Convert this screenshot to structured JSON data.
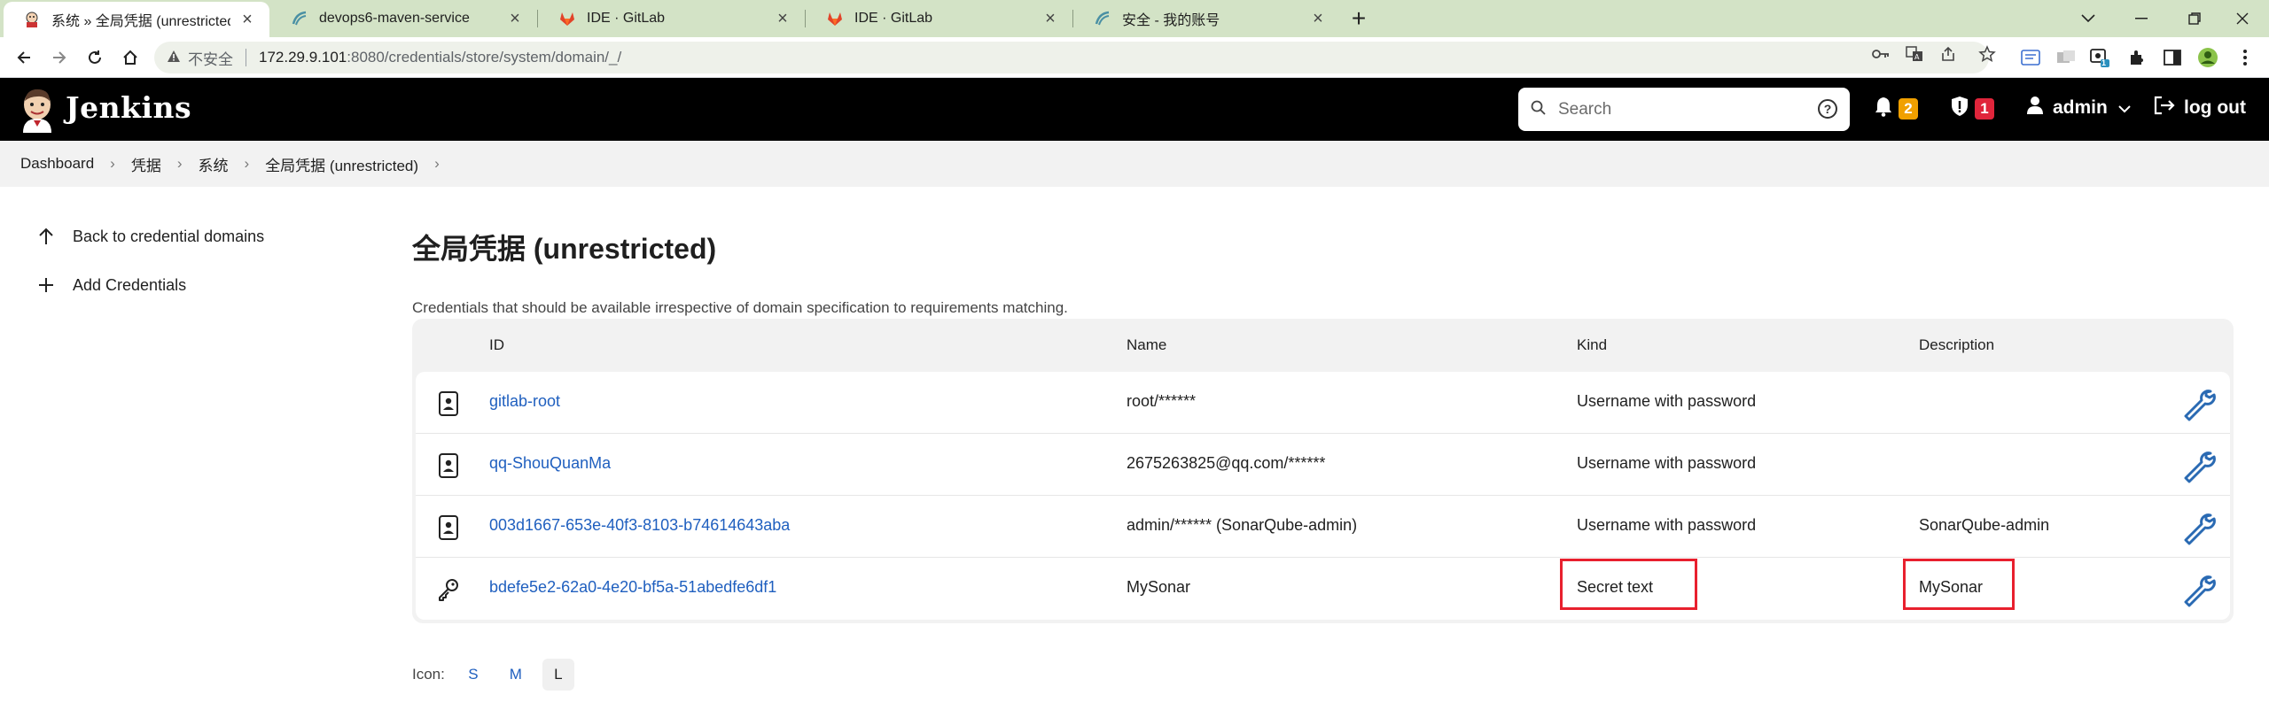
{
  "browser": {
    "tabs": [
      {
        "title": "系统 » 全局凭据 (unrestricted) |",
        "active": true
      },
      {
        "title": "devops6-maven-service",
        "active": false
      },
      {
        "title": "IDE · GitLab",
        "active": false
      },
      {
        "title": "IDE · GitLab",
        "active": false
      },
      {
        "title": "安全 - 我的账号",
        "active": false
      }
    ],
    "new_tab": "+",
    "insecure_label": "不安全",
    "url_host": "172.29.9.101",
    "url_path": ":8080/credentials/store/system/domain/_/",
    "extension_badge": "1"
  },
  "header": {
    "app_name": "Jenkins",
    "search_placeholder": "Search",
    "notifications_count": "2",
    "security_count": "1",
    "user": "admin",
    "logout": "log out"
  },
  "breadcrumb": [
    "Dashboard",
    "凭据",
    "系统",
    "全局凭据 (unrestricted)"
  ],
  "sidebar": {
    "items": [
      {
        "label": "Back to credential domains"
      },
      {
        "label": "Add Credentials"
      }
    ]
  },
  "main": {
    "title": "全局凭据 (unrestricted)",
    "description": "Credentials that should be available irrespective of domain specification to requirements matching.",
    "columns": [
      "ID",
      "Name",
      "Kind",
      "Description"
    ],
    "rows": [
      {
        "id": "gitlab-root",
        "name": "root/******",
        "kind": "Username with password",
        "description": "",
        "icon": "user-card-icon"
      },
      {
        "id": "qq-ShouQuanMa",
        "name": "2675263825@qq.com/******",
        "kind": "Username with password",
        "description": "",
        "icon": "user-card-icon"
      },
      {
        "id": "003d1667-653e-40f3-8103-b74614643aba",
        "name": "admin/****** (SonarQube-admin)",
        "kind": "Username with password",
        "description": "SonarQube-admin",
        "icon": "user-card-icon"
      },
      {
        "id": "bdefe5e2-62a0-4e20-bf5a-51abedfe6df1",
        "name": "MySonar",
        "kind": "Secret text",
        "description": "MySonar",
        "icon": "key-icon"
      }
    ],
    "icon_size_label": "Icon:",
    "icon_sizes": [
      "S",
      "M",
      "L"
    ],
    "icon_size_selected": "L"
  },
  "colors": {
    "header_bg": "#000000",
    "link": "#1f5fbf",
    "highlight": "#e8202e",
    "tabstrip": "#d3e3c6"
  }
}
